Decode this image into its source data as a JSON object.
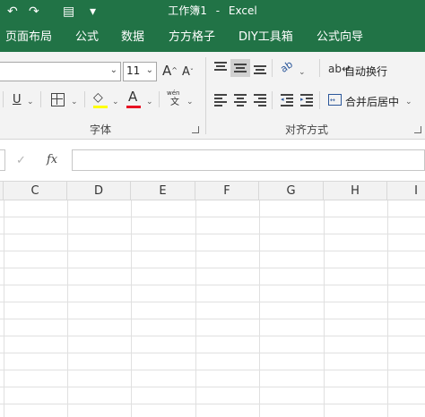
{
  "titlebar": {
    "doc_title": "工作簿1",
    "separator": "-",
    "app_name": "Excel",
    "undo_glyph": "↶",
    "redo_glyph": "↷",
    "form_icon_glyph": "▤",
    "customize_glyph": "▾"
  },
  "tabs": [
    "页面布局",
    "公式",
    "数据",
    "方方格子",
    "DIY工具箱",
    "公式向导"
  ],
  "ribbon": {
    "font_name": "",
    "font_size": "11",
    "grow_font": "A",
    "shrink_font": "A",
    "underline": "U",
    "font_color_letter": "A",
    "phonetic_top": "wén",
    "phonetic_bottom": "文",
    "font_group_label": "字体",
    "align_group_label": "对齐方式",
    "wrap_text_label": "自动换行",
    "merge_center_label": "合并后居中",
    "orientation_glyph": "ab",
    "colors": {
      "fill_color": "#ffff00",
      "font_color": "#e81123"
    }
  },
  "formula_bar": {
    "cancel_glyph": "✓",
    "fx_label": "fx",
    "value": ""
  },
  "columns": [
    "C",
    "D",
    "E",
    "F",
    "G",
    "H",
    "I"
  ],
  "colors": {
    "accent": "#217346",
    "ribbon_bg": "#f3f3f3",
    "gridline": "#e0e0e0"
  }
}
